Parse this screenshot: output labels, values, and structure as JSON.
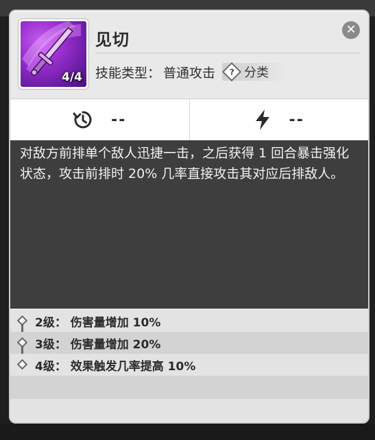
{
  "skill": {
    "name": "见切",
    "icon_name": "sword-skill-icon",
    "icon_count": "4/4",
    "type_label": "技能类型：",
    "type_value": "普通攻击",
    "category_label": "分类",
    "category_icon": "question-diamond-icon"
  },
  "stats": {
    "cooldown_icon": "cooldown-icon",
    "cooldown_value": "--",
    "energy_icon": "lightning-icon",
    "energy_value": "--"
  },
  "description": "对敌方前排单个敌人迅捷一击，之后获得 1 回合暴击强化状态，攻击前排时 20% 几率直接攻击其对应后排敌人。",
  "levels": [
    {
      "text": "2级：  伤害量增加 10%"
    },
    {
      "text": "3级：  伤害量增加 20%"
    },
    {
      "text": "4级：  效果触发几率提高 10%"
    }
  ],
  "colors": {
    "icon_purple": "#9b2fd0",
    "description_bg": "#3e3e3e",
    "card_bg": "#e9e9e9"
  }
}
